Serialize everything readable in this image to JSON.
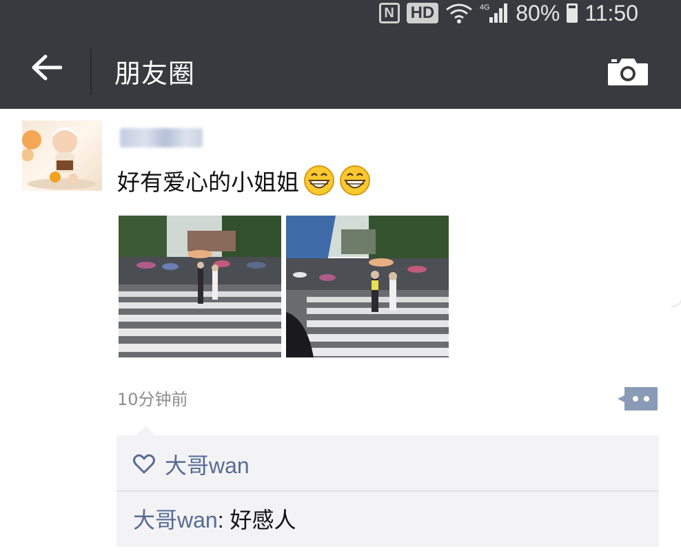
{
  "status_bar": {
    "nfc": "N",
    "hd": "HD",
    "network": "4G",
    "battery": "80%",
    "time": "11:50"
  },
  "header": {
    "title": "朋友圈",
    "back_icon": "arrow-left-icon",
    "camera_icon": "camera-icon"
  },
  "post": {
    "author_blurred": true,
    "text": "好有爱心的小姐姐",
    "emoji_count": 2,
    "emoji_icon": "grinning-face-icon",
    "photos": [
      "photo-crosswalk-1",
      "photo-crosswalk-2"
    ],
    "time": "10分钟前",
    "likes": [
      "大哥wan"
    ],
    "comments": [
      {
        "author": "大哥wan",
        "sep": ": ",
        "text": "好感人"
      }
    ]
  },
  "colors": {
    "header_bg": "#393a3f",
    "link_blue": "#576b95",
    "comment_bg": "#f3f3f5",
    "time_gray": "#8c8c8c"
  }
}
